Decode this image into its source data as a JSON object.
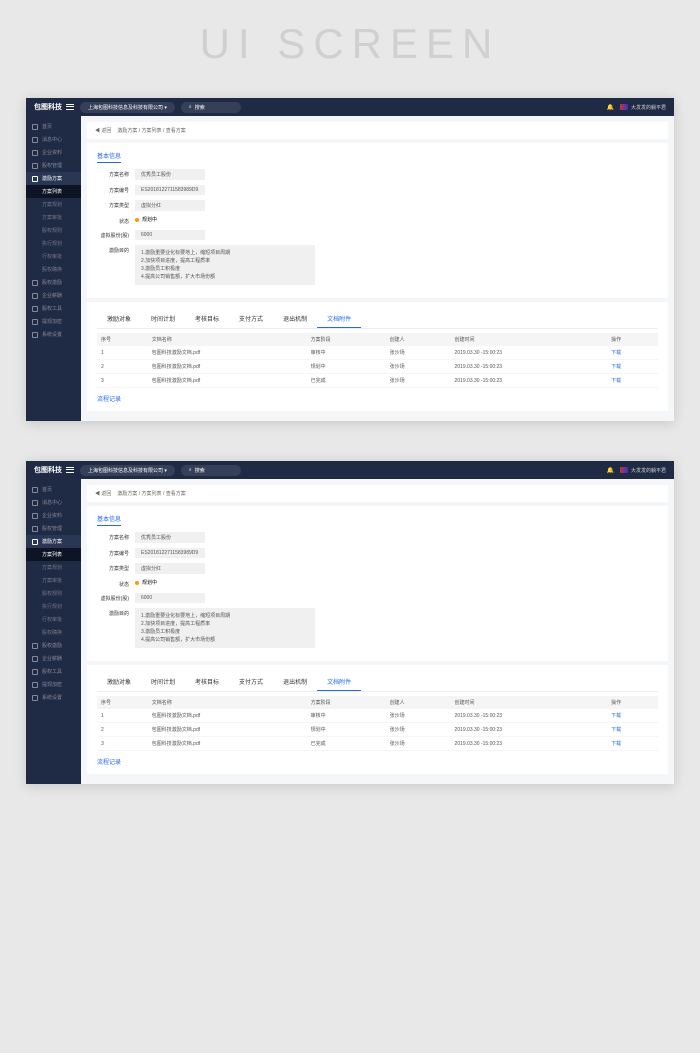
{
  "hero": "UI SCREEN",
  "header": {
    "logo": "包图科技",
    "company": "上海包图科技信息及科技有限公司 ▾",
    "search_placeholder": "搜索",
    "user_text": "大发发的躺平君"
  },
  "sidebar": {
    "items": [
      {
        "label": "首页"
      },
      {
        "label": "消息中心"
      },
      {
        "label": "企业资料"
      },
      {
        "label": "股权管理"
      },
      {
        "label": "激励方案"
      },
      {
        "label": "股权激励"
      },
      {
        "label": "企业薪酬"
      },
      {
        "label": "股权工具"
      },
      {
        "label": "提现加密"
      },
      {
        "label": "系统设置"
      }
    ],
    "subs": [
      {
        "label": "方案列表"
      },
      {
        "label": "方案规划"
      },
      {
        "label": "方案审批"
      },
      {
        "label": "股权规则"
      },
      {
        "label": "执行规划"
      },
      {
        "label": "行权审批"
      },
      {
        "label": "股权确换"
      }
    ]
  },
  "breadcrumb": {
    "back": "◀ 返回",
    "path": "激励方案 / 方案列表 / 查看方案"
  },
  "basic": {
    "title": "基本信息",
    "rows": {
      "name_label": "方案名称",
      "name_val": "优秀员工股份",
      "code_label": "方案编号",
      "code_val": "ES2018122711583989D9",
      "type_label": "方案类型",
      "type_val": "虚拟分红",
      "status_label": "状态",
      "status_val": "规划中",
      "shares_label": "虚拟股份(股)",
      "shares_val": "6000",
      "goal_label": "激励目的",
      "goals": [
        "1.激励重要业化标要地上，缩短项目周期",
        "2.加快项目进度，提高工程质率",
        "3.激励员工积极度",
        "4.提高公司销售额，扩大市场份额"
      ]
    }
  },
  "tabs": [
    "激励对象",
    "时间计划",
    "考核目标",
    "支付方式",
    "退出机制",
    "文档附件"
  ],
  "table": {
    "headers": [
      "序号",
      "文档名称",
      "方案阶段",
      "创建人",
      "创建时间",
      "操作"
    ],
    "rows": [
      {
        "idx": "1",
        "name": "包图科技激励文档.pdf",
        "stage": "审核中",
        "creator": "张沙场",
        "time": "2019.03.30 -15:00:23",
        "op": "下载"
      },
      {
        "idx": "2",
        "name": "包图科技激励文档.pdf",
        "stage": "规划中",
        "creator": "张沙场",
        "time": "2019.03.30 -15:00:23",
        "op": "下载"
      },
      {
        "idx": "3",
        "name": "包图科技激励文档.pdf",
        "stage": "已完成",
        "creator": "张沙场",
        "time": "2019.03.30 -15:00:23",
        "op": "下载"
      }
    ]
  },
  "flow_title": "流程记录"
}
